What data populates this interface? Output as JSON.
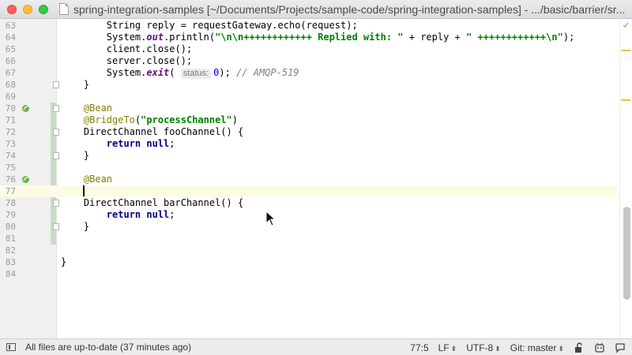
{
  "window": {
    "title": "spring-integration-samples [~/Documents/Projects/sample-code/spring-integration-samples] - .../basic/barrier/sr..."
  },
  "editor": {
    "lines": [
      {
        "num": "63",
        "html": "        String reply = requestGateway.echo(request);"
      },
      {
        "num": "64",
        "html": "        System.<span class=\"static\">out</span>.println(<span class=\"str\">\"\\n\\n++++++++++++ Replied with: \"</span> + reply + <span class=\"str\">\" ++++++++++++\\n\"</span>);"
      },
      {
        "num": "65",
        "html": "        client.close();"
      },
      {
        "num": "66",
        "html": "        server.close();"
      },
      {
        "num": "67",
        "html": "        System.<span class=\"static\">exit</span>( <span class=\"hint\">status:</span><span class=\"num\">0</span>); <span class=\"cmt\">// AMQP-519</span>"
      },
      {
        "num": "68",
        "html": "    }"
      },
      {
        "num": "69",
        "html": ""
      },
      {
        "num": "70",
        "html": "    <span class=\"ann\">@Bean</span>"
      },
      {
        "num": "71",
        "html": "    <span class=\"ann\">@BridgeTo</span>(<span class=\"str\">\"processChannel\"</span>)"
      },
      {
        "num": "72",
        "html": "    DirectChannel fooChannel() {"
      },
      {
        "num": "73",
        "html": "        <span class=\"kw\">return null</span>;"
      },
      {
        "num": "74",
        "html": "    }"
      },
      {
        "num": "75",
        "html": ""
      },
      {
        "num": "76",
        "html": "    <span class=\"ann\">@Bean</span>"
      },
      {
        "num": "77",
        "html": ""
      },
      {
        "num": "78",
        "html": "    DirectChannel barChannel() {"
      },
      {
        "num": "79",
        "html": "        <span class=\"kw\">return null</span>;"
      },
      {
        "num": "80",
        "html": "    }"
      },
      {
        "num": "81",
        "html": ""
      },
      {
        "num": "82",
        "html": ""
      },
      {
        "num": "83",
        "html": "}"
      },
      {
        "num": "84",
        "html": ""
      }
    ],
    "current_line": "77",
    "bean_icon_lines": [
      "70",
      "76"
    ],
    "fold_lines": [
      "68",
      "70",
      "72",
      "74",
      "78",
      "80"
    ]
  },
  "status": {
    "message": "All files are up-to-date (37 minutes ago)",
    "position": "77:5",
    "line_separator": "LF",
    "encoding": "UTF-8",
    "vcs": "Git: master"
  },
  "colors": {
    "annotation": "#808000",
    "keyword": "#000080",
    "string": "#008000",
    "current_line": "#fdfbe6",
    "change_marker": "#c6dfc2"
  }
}
